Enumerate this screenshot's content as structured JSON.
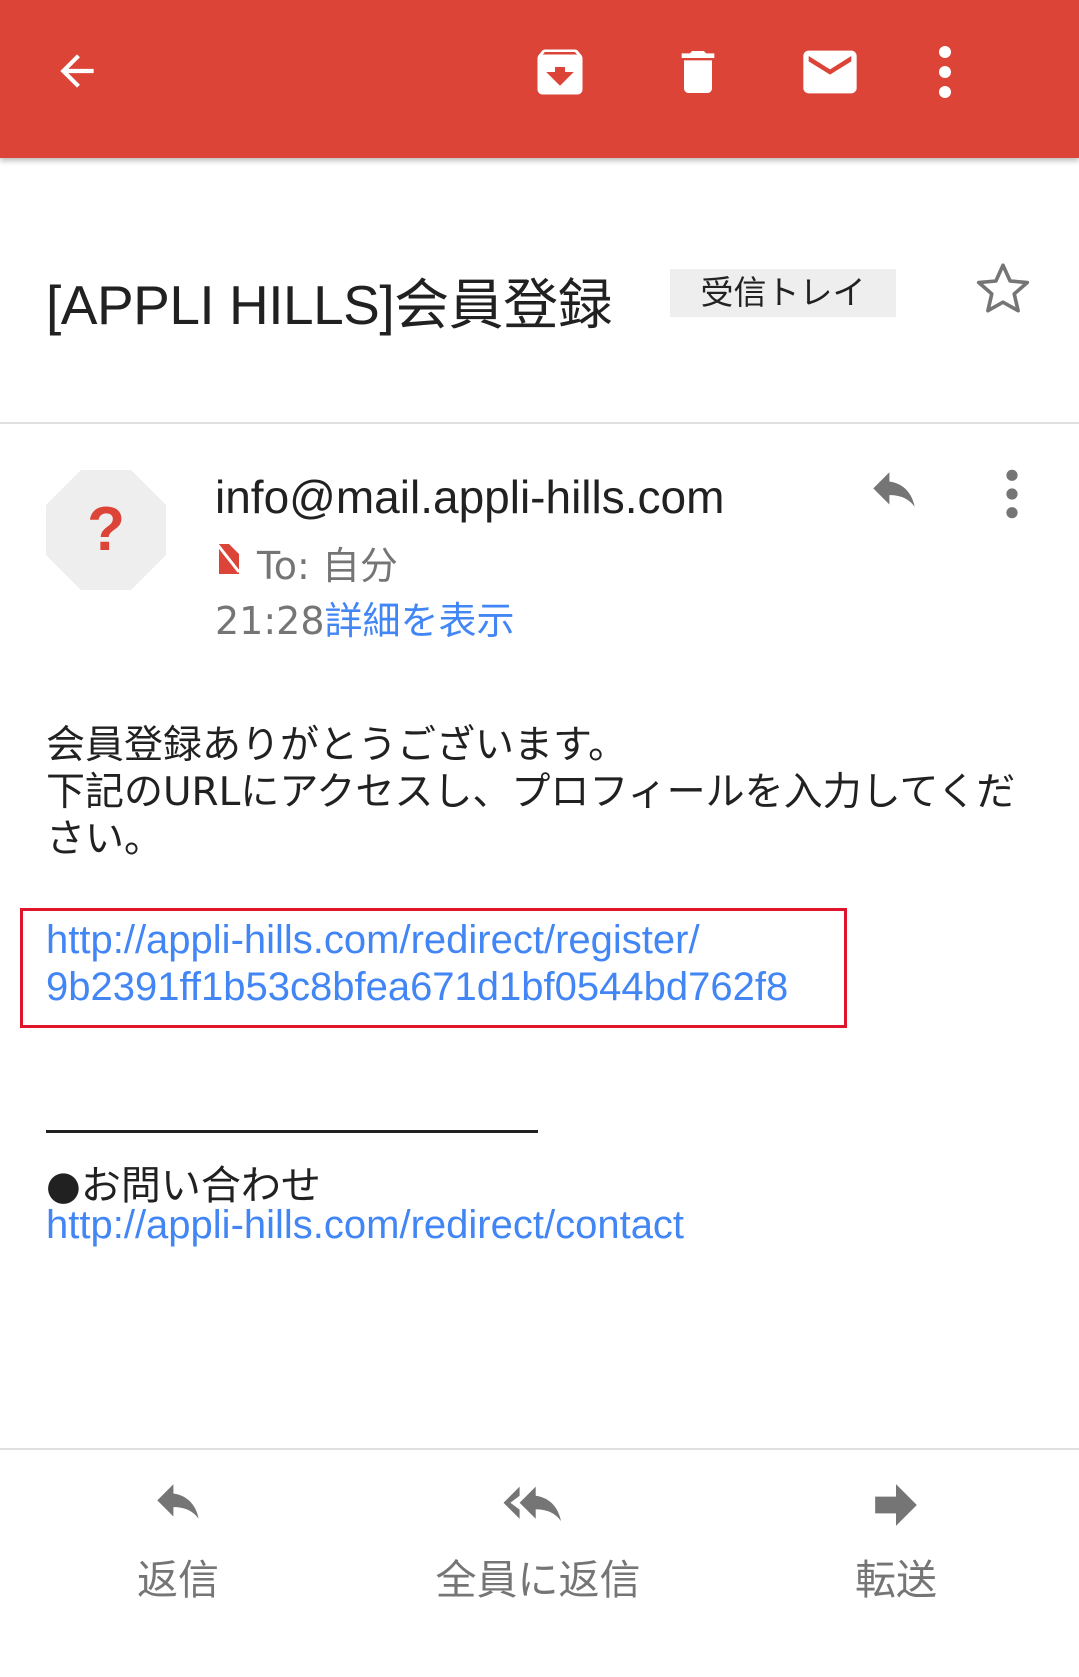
{
  "toolbar": {
    "icons": [
      "back-arrow-icon",
      "archive-icon",
      "delete-icon",
      "mark-unread-icon",
      "more-vert-icon"
    ],
    "color": "#db4437"
  },
  "subject": {
    "title": "[APPLI HILLS]会員登録",
    "label": "受信トレイ"
  },
  "message": {
    "sender": "info@mail.appli-hills.com",
    "to": "To: 自分",
    "time": "21:28",
    "details_link": "詳細を表示",
    "body_text": "会員登録ありがとうございます。\n下記のURLにアクセスし、プロフィールを入力してください。",
    "register_link": "http://appli-hills.com/redirect/register/\n9b2391ff1b53c8bfea671d1bf0544bd762f8",
    "contact_label": "●お問い合わせ",
    "contact_link": "http://appli-hills.com/redirect/contact"
  },
  "actions": {
    "reply": "返信",
    "reply_all": "全員に返信",
    "forward": "転送"
  },
  "colors": {
    "link": "#4285f4",
    "highlight_box": "#e0142b"
  }
}
